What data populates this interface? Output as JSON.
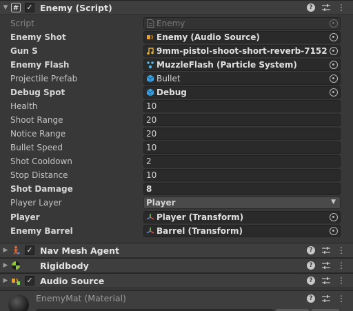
{
  "enemy_component": {
    "title": "Enemy (Script)",
    "enabled": true,
    "icon": "hash-script-icon",
    "fields": [
      {
        "label": "Script",
        "value": "Enemy",
        "icon": "script-file-icon",
        "kind": "object",
        "style": "disabled"
      },
      {
        "label": "Enemy Shot",
        "value": "Enemy (Audio Source)",
        "icon": "audio-source-icon",
        "kind": "object",
        "style": "bold"
      },
      {
        "label": "Gun S",
        "value": "9mm-pistol-shoot-short-reverb-7152",
        "icon": "audio-clip-icon",
        "kind": "object",
        "style": "bold"
      },
      {
        "label": "Enemy Flash",
        "value": "MuzzleFlash (Particle System)",
        "icon": "particle-system-icon",
        "kind": "object",
        "style": "bold"
      },
      {
        "label": "Projectile Prefab",
        "value": "Bullet",
        "icon": "prefab-icon",
        "kind": "object",
        "style": "normal"
      },
      {
        "label": "Debug Spot",
        "value": "Debug",
        "icon": "prefab-icon",
        "kind": "object",
        "style": "bold"
      },
      {
        "label": "Health",
        "value": "10",
        "kind": "number",
        "style": "normal"
      },
      {
        "label": "Shoot Range",
        "value": "20",
        "kind": "number",
        "style": "normal"
      },
      {
        "label": "Notice Range",
        "value": "20",
        "kind": "number",
        "style": "normal"
      },
      {
        "label": "Bullet Speed",
        "value": "10",
        "kind": "number",
        "style": "normal"
      },
      {
        "label": "Shot Cooldown",
        "value": "2",
        "kind": "number",
        "style": "normal"
      },
      {
        "label": "Stop Distance",
        "value": "10",
        "kind": "number",
        "style": "normal"
      },
      {
        "label": "Shot Damage",
        "value": "8",
        "kind": "number",
        "style": "bold"
      },
      {
        "label": "Player Layer",
        "value": "Player",
        "kind": "dropdown",
        "style": "normal"
      },
      {
        "label": "Player",
        "value": "Player (Transform)",
        "icon": "transform-icon",
        "kind": "object",
        "style": "bold"
      },
      {
        "label": "Enemy Barrel",
        "value": "Barrel (Transform)",
        "icon": "transform-icon",
        "kind": "object",
        "style": "bold"
      }
    ]
  },
  "collapsed_components": [
    {
      "title": "Nav Mesh Agent",
      "icon": "nav-mesh-agent-icon",
      "has_checkbox": true,
      "enabled": true
    },
    {
      "title": "Rigidbody",
      "icon": "rigidbody-icon",
      "has_checkbox": false
    },
    {
      "title": "Audio Source",
      "icon": "audio-source-icon",
      "has_checkbox": true,
      "enabled": true
    }
  ],
  "material": {
    "title": "EnemyMat (Material)",
    "icon": "material-sphere-icon"
  },
  "header_icons": [
    "help-icon",
    "presets-icon",
    "more-icon"
  ]
}
